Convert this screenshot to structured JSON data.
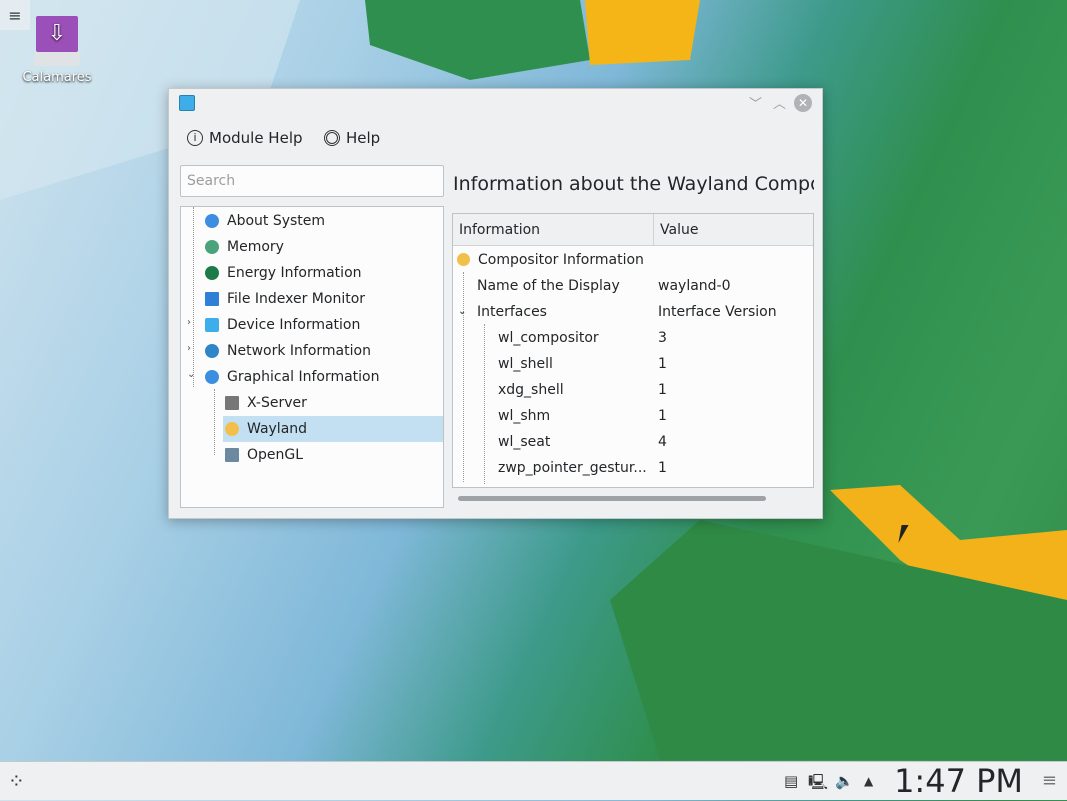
{
  "desktop": {
    "icon_label": "Calamares"
  },
  "window": {
    "toolbar": {
      "module_help": "Module Help",
      "help": "Help"
    },
    "search_placeholder": "Search",
    "tree": [
      {
        "label": "About System",
        "color": "#3d8ee0"
      },
      {
        "label": "Memory",
        "color": "#4aa37a"
      },
      {
        "label": "Energy Information",
        "color": "#1f7a4a"
      },
      {
        "label": "File Indexer Monitor",
        "color": "#2f7fd6"
      },
      {
        "label": "Device Information",
        "color": "#3daee9"
      },
      {
        "label": "Network Information",
        "color": "#2e86c9"
      },
      {
        "label": "Graphical Information",
        "color": "#3b8fe0"
      },
      {
        "label": "X-Server",
        "color": "#777777"
      },
      {
        "label": "Wayland",
        "color": "#f2c04a"
      },
      {
        "label": "OpenGL",
        "color": "#6b8aa0"
      }
    ],
    "title": "Information about the Wayland Compositor",
    "table": {
      "headers": [
        "Information",
        "Value"
      ],
      "rows": [
        {
          "name": "Compositor Information",
          "value": ""
        },
        {
          "name": "Name of the Display",
          "value": "wayland-0"
        },
        {
          "name": "Interfaces",
          "value": "Interface Version"
        },
        {
          "name": "wl_compositor",
          "value": "3"
        },
        {
          "name": "wl_shell",
          "value": "1"
        },
        {
          "name": "xdg_shell",
          "value": "1"
        },
        {
          "name": "wl_shm",
          "value": "1"
        },
        {
          "name": "wl_seat",
          "value": "4"
        },
        {
          "name": "zwp_pointer_gestur...",
          "value": "1"
        }
      ]
    }
  },
  "panel": {
    "clock": "1:47 PM"
  }
}
